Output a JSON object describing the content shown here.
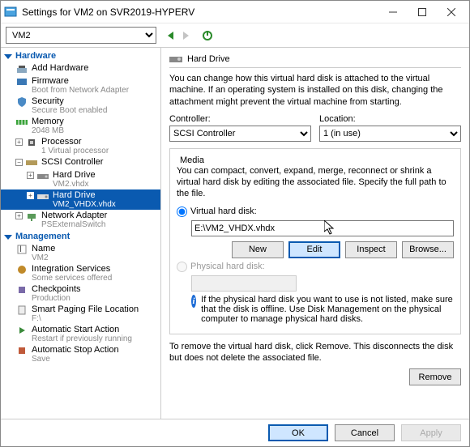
{
  "window": {
    "title": "Settings for VM2 on SVR2019-HYPERV"
  },
  "toolbar": {
    "vm_selected": "VM2"
  },
  "tree": {
    "hardware_label": "Hardware",
    "management_label": "Management",
    "add_hardware": "Add Hardware",
    "firmware": {
      "label": "Firmware",
      "sub": "Boot from Network Adapter"
    },
    "security": {
      "label": "Security",
      "sub": "Secure Boot enabled"
    },
    "memory": {
      "label": "Memory",
      "sub": "2048 MB"
    },
    "processor": {
      "label": "Processor",
      "sub": "1 Virtual processor"
    },
    "scsi": {
      "label": "SCSI Controller"
    },
    "hd1": {
      "label": "Hard Drive",
      "sub": "VM2.vhdx"
    },
    "hd2": {
      "label": "Hard Drive",
      "sub": "VM2_VHDX.vhdx"
    },
    "net": {
      "label": "Network Adapter",
      "sub": "PSExternalSwitch"
    },
    "name": {
      "label": "Name",
      "sub": "VM2"
    },
    "integ": {
      "label": "Integration Services",
      "sub": "Some services offered"
    },
    "check": {
      "label": "Checkpoints",
      "sub": "Production"
    },
    "paging": {
      "label": "Smart Paging File Location",
      "sub": "F:\\"
    },
    "start": {
      "label": "Automatic Start Action",
      "sub": "Restart if previously running"
    },
    "stop": {
      "label": "Automatic Stop Action",
      "sub": "Save"
    }
  },
  "detail": {
    "heading": "Hard Drive",
    "desc": "You can change how this virtual hard disk is attached to the virtual machine. If an operating system is installed on this disk, changing the attachment might prevent the virtual machine from starting.",
    "controller_label": "Controller:",
    "controller_value": "SCSI Controller",
    "location_label": "Location:",
    "location_value": "1 (in use)",
    "media_label": "Media",
    "media_desc": "You can compact, convert, expand, merge, reconnect or shrink a virtual hard disk by editing the associated file. Specify the full path to the file.",
    "vhd_label": "Virtual hard disk:",
    "vhd_path": "E:\\VM2_VHDX.vhdx",
    "new_btn": "New",
    "edit_btn": "Edit",
    "inspect_btn": "Inspect",
    "browse_btn": "Browse...",
    "phys_label": "Physical hard disk:",
    "info": "If the physical hard disk you want to use is not listed, make sure that the disk is offline. Use Disk Management on the physical computer to manage physical hard disks.",
    "remove_desc": "To remove the virtual hard disk, click Remove. This disconnects the disk but does not delete the associated file.",
    "remove_btn": "Remove"
  },
  "footer": {
    "ok": "OK",
    "cancel": "Cancel",
    "apply": "Apply"
  }
}
